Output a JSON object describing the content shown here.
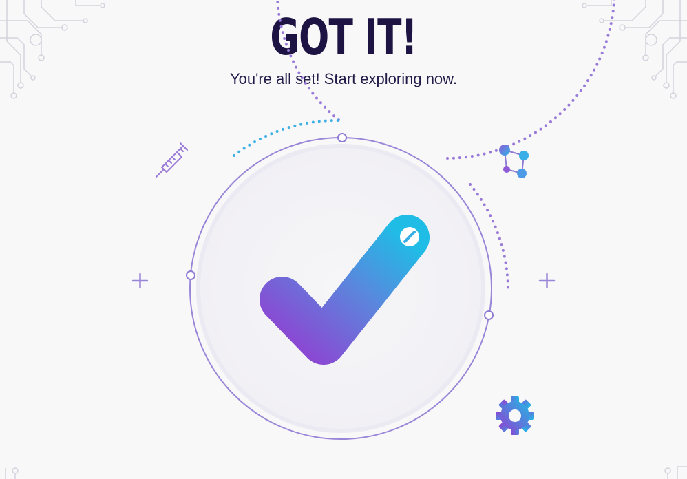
{
  "header": {
    "title": "GOT IT!",
    "subtitle": "You're all set! Start exploring now."
  },
  "icons": {
    "center": "checkmark-icon",
    "top_left": "syringe-icon",
    "top_right": "molecule-icon",
    "bottom_right": "gear-icon",
    "side": "plus-icon",
    "corners": "circuit-icon"
  },
  "colors": {
    "background": "#f8f8f9",
    "title": "#1d1443",
    "accent_purple": "#8a4fd6",
    "accent_blue": "#27b9e6",
    "ring": "#8f7ad4"
  }
}
